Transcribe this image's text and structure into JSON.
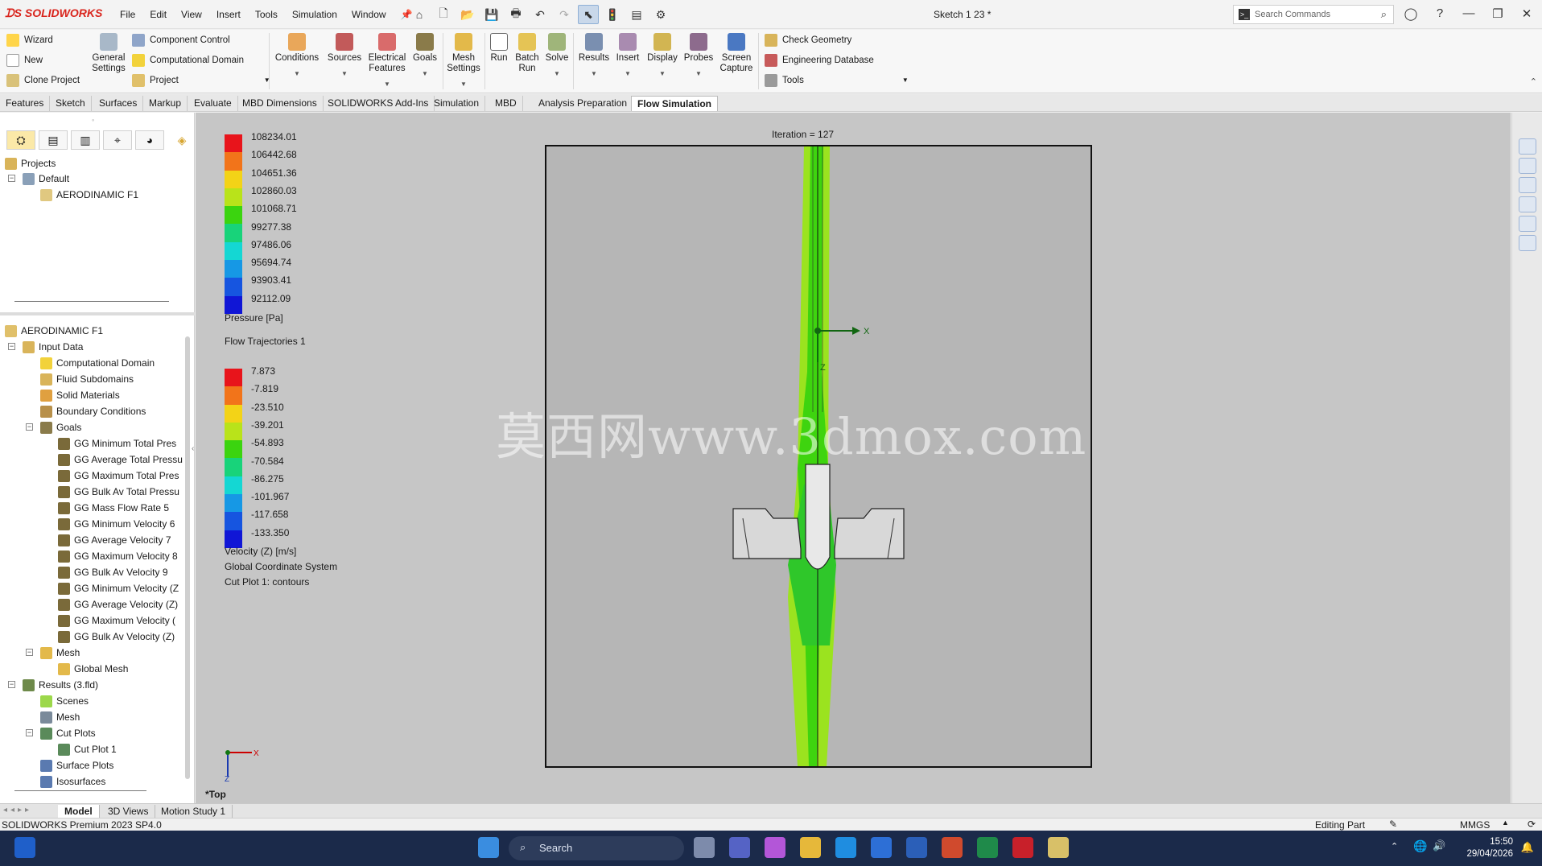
{
  "app": {
    "brand": "SOLIDWORKS",
    "title": "Sketch 1 23 *"
  },
  "menu": [
    "File",
    "Edit",
    "View",
    "Insert",
    "Tools",
    "Simulation",
    "Window"
  ],
  "search": {
    "placeholder": "Search Commands"
  },
  "ribbon": {
    "left_col": [
      "Wizard",
      "New",
      "Clone Project"
    ],
    "general": "General Settings",
    "mid_col": [
      "Component Control",
      "Computational Domain",
      "Project"
    ],
    "buttons": [
      "Conditions",
      "Sources",
      "Electrical Features",
      "Goals",
      "Mesh Settings",
      "Run",
      "Batch Run",
      "Solve",
      "Results",
      "Insert",
      "Display",
      "Probes",
      "Screen Capture"
    ],
    "right_col": [
      "Check Geometry",
      "Engineering Database",
      "Tools"
    ]
  },
  "tabs": [
    "Features",
    "Sketch",
    "Surfaces",
    "Markup",
    "Evaluate",
    "MBD Dimensions",
    "SOLIDWORKS Add-Ins",
    "Simulation",
    "MBD",
    "Analysis Preparation",
    "Flow Simulation"
  ],
  "tree_top": {
    "projects": "Projects",
    "default": "Default",
    "model": "AERODINAMIC F1"
  },
  "tree": [
    {
      "label": "AERODINAMIC F1",
      "level": 0
    },
    {
      "label": "Input Data",
      "level": 1
    },
    {
      "label": "Computational Domain",
      "level": 2
    },
    {
      "label": "Fluid Subdomains",
      "level": 2
    },
    {
      "label": "Solid Materials",
      "level": 2
    },
    {
      "label": "Boundary Conditions",
      "level": 2
    },
    {
      "label": "Goals",
      "level": 2
    },
    {
      "label": "GG Minimum Total Pres",
      "level": 3
    },
    {
      "label": "GG Average Total Pressu",
      "level": 3
    },
    {
      "label": "GG Maximum Total Pres",
      "level": 3
    },
    {
      "label": "GG Bulk Av Total Pressu",
      "level": 3
    },
    {
      "label": "GG Mass Flow Rate 5",
      "level": 3
    },
    {
      "label": "GG Minimum Velocity 6",
      "level": 3
    },
    {
      "label": "GG Average Velocity 7",
      "level": 3
    },
    {
      "label": "GG Maximum Velocity 8",
      "level": 3
    },
    {
      "label": "GG Bulk Av Velocity 9",
      "level": 3
    },
    {
      "label": "GG Minimum Velocity (Z",
      "level": 3
    },
    {
      "label": "GG Average Velocity (Z)",
      "level": 3
    },
    {
      "label": "GG Maximum Velocity (",
      "level": 3
    },
    {
      "label": "GG Bulk Av Velocity (Z) ",
      "level": 3
    },
    {
      "label": "Mesh",
      "level": 2
    },
    {
      "label": "Global Mesh",
      "level": 3
    },
    {
      "label": "Results (3.fld)",
      "level": 1
    },
    {
      "label": "Scenes",
      "level": 2
    },
    {
      "label": "Mesh",
      "level": 2
    },
    {
      "label": "Cut Plots",
      "level": 2
    },
    {
      "label": "Cut Plot 1",
      "level": 3
    },
    {
      "label": "Surface Plots",
      "level": 2
    },
    {
      "label": "Isosurfaces",
      "level": 2
    }
  ],
  "legend_pressure": {
    "values": [
      "108234.01",
      "106442.68",
      "104651.36",
      "102860.03",
      "101068.71",
      "99277.38",
      "97486.06",
      "95694.74",
      "93903.41",
      "92112.09"
    ],
    "label": "Pressure [Pa]",
    "colors": [
      "#e8141b",
      "#f2741a",
      "#f3d317",
      "#b9e31a",
      "#3bd40f",
      "#18d37a",
      "#14d7d3",
      "#1698e5",
      "#1655e0",
      "#1016d6"
    ]
  },
  "legend_traj": "Flow Trajectories 1",
  "legend_velocity": {
    "values": [
      "7.873",
      "-7.819",
      "-23.510",
      "-39.201",
      "-54.893",
      "-70.584",
      "-86.275",
      "-101.967",
      "-117.658",
      "-133.350"
    ],
    "label": "Velocity (Z) [m/s]",
    "colors": [
      "#e8141b",
      "#f2741a",
      "#f3d317",
      "#b9e31a",
      "#3bd40f",
      "#18d37a",
      "#14d7d3",
      "#1698e5",
      "#1655e0",
      "#1016d6"
    ]
  },
  "viewport": {
    "coord": "Global Coordinate System",
    "cutplot": "Cut Plot 1: contours",
    "iteration": "Iteration = 127",
    "watermark": "莫西网www.3dmox.com",
    "view_name": "*Top",
    "axis_x": "X",
    "axis_z": "Z"
  },
  "bottom_tabs": [
    "Model",
    "3D Views",
    "Motion Study 1"
  ],
  "status": {
    "left": "SOLIDWORKS Premium 2023 SP4.0",
    "editing": "Editing Part",
    "units": "MMGS"
  },
  "taskbar": {
    "search": "Search",
    "time": "15:50",
    "date": "29/04/2026"
  }
}
